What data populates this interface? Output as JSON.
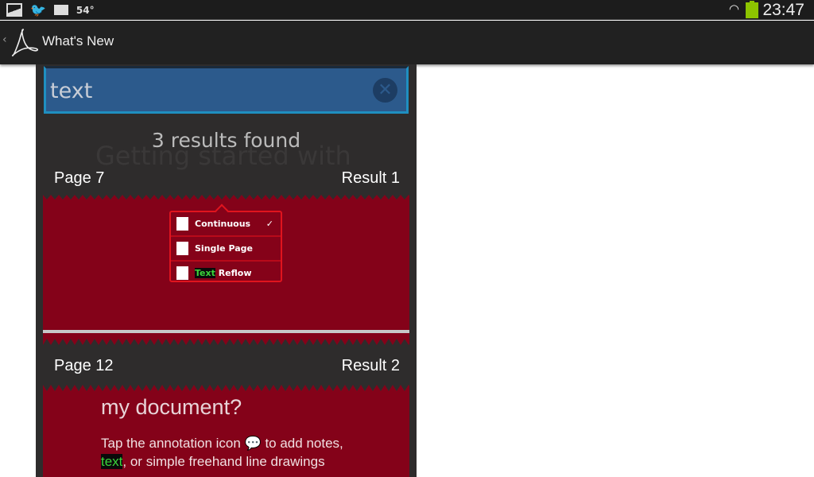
{
  "status_bar": {
    "temperature": "54°",
    "time": "23:47",
    "icons": [
      "gallery-icon",
      "twitter-icon",
      "mail-icon",
      "wifi-icon",
      "battery-icon"
    ],
    "battery_color": "#8dc400"
  },
  "action_bar": {
    "title": "What's New",
    "icon": "adobe-reader-logo"
  },
  "search": {
    "value": "text",
    "clear_icon": "clear-icon"
  },
  "results": {
    "count_text": "3 results found",
    "background_text": "Getting started with",
    "items": [
      {
        "page": "Page 7",
        "result": "Result 1",
        "menu": [
          {
            "label": "Continuous",
            "checked": true,
            "icon": "continuous-icon"
          },
          {
            "label": "Single Page",
            "icon": "single-page-icon"
          },
          {
            "label_highlight": "Text",
            "label_rest": " Reflow",
            "icon": "text-reflow-icon"
          }
        ]
      },
      {
        "page": "Page 12",
        "result": "Result 2",
        "heading": "my document?",
        "body_line1": "Tap the annotation icon",
        "body_line1b": "to add notes,",
        "body_line2_highlight": "text",
        "body_line2_rest": ", or simple freehand line drawings"
      }
    ]
  },
  "colors": {
    "accent": "#1f8fc0",
    "search_bg": "#2c5a8c",
    "page_red": "#840219",
    "highlight": "#3bd43b"
  }
}
